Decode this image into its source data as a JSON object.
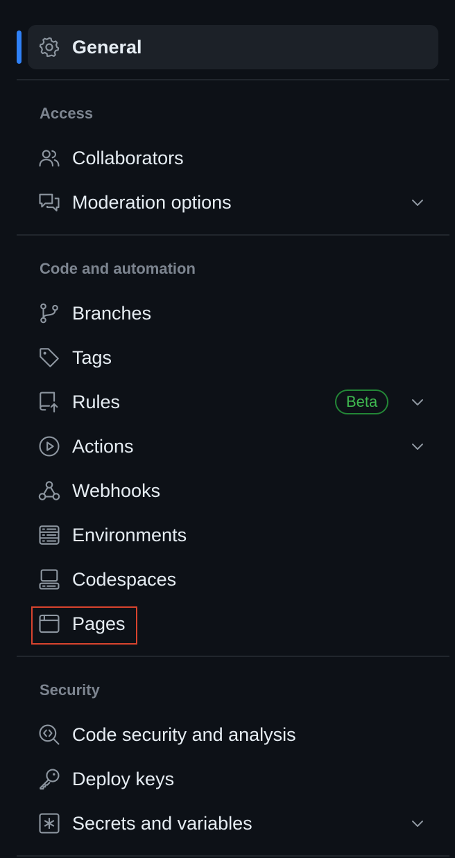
{
  "colors": {
    "background": "#0d1117",
    "active_indicator": "#2f81f7",
    "active_item_background": "#1c2128",
    "text": "#e6edf3",
    "muted_text": "#7d8590",
    "icon": "#8d96a0",
    "divider": "#21262d",
    "badge_border": "#238636",
    "badge_text": "#3fb950",
    "highlight_border": "#d9442e"
  },
  "general": {
    "label": "General",
    "icon": "gear-icon",
    "active": true
  },
  "sections": {
    "access": {
      "heading": "Access",
      "items": [
        {
          "label": "Collaborators",
          "icon": "people-icon"
        },
        {
          "label": "Moderation options",
          "icon": "comment-discussion-icon",
          "expandable": true
        }
      ]
    },
    "code_automation": {
      "heading": "Code and automation",
      "items": [
        {
          "label": "Branches",
          "icon": "git-branch-icon"
        },
        {
          "label": "Tags",
          "icon": "tag-icon"
        },
        {
          "label": "Rules",
          "icon": "repo-push-icon",
          "badge": "Beta",
          "expandable": true
        },
        {
          "label": "Actions",
          "icon": "play-icon",
          "expandable": true
        },
        {
          "label": "Webhooks",
          "icon": "webhook-icon"
        },
        {
          "label": "Environments",
          "icon": "server-icon"
        },
        {
          "label": "Codespaces",
          "icon": "codespaces-icon"
        },
        {
          "label": "Pages",
          "icon": "browser-icon",
          "highlighted": true
        }
      ]
    },
    "security": {
      "heading": "Security",
      "items": [
        {
          "label": "Code security and analysis",
          "icon": "codescan-icon"
        },
        {
          "label": "Deploy keys",
          "icon": "key-icon"
        },
        {
          "label": "Secrets and variables",
          "icon": "key-asterisk-icon",
          "expandable": true
        }
      ]
    }
  }
}
